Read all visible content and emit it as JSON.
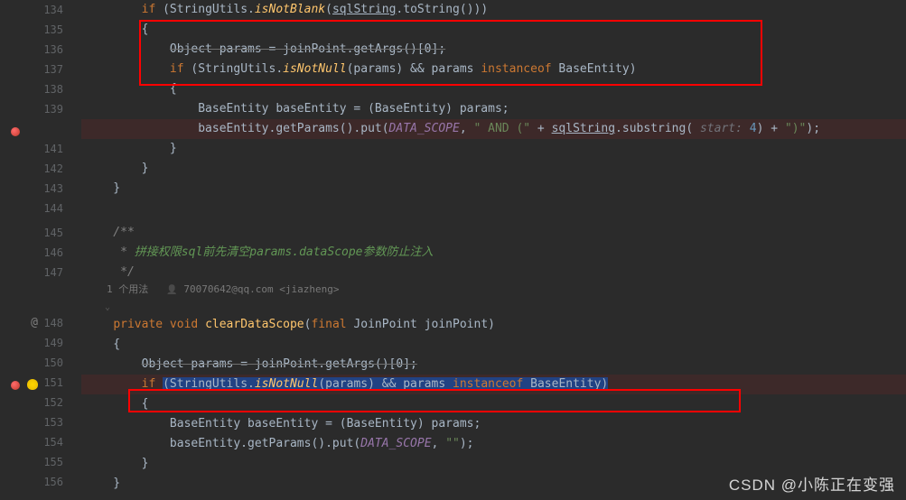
{
  "gutter": {
    "lines": [
      "134",
      "135",
      "136",
      "137",
      "138",
      "139",
      "",
      "141",
      "142",
      "143",
      "144",
      "",
      "145",
      "146",
      "147",
      "",
      "",
      "148",
      "149",
      "150",
      "151",
      "152",
      "153",
      "154",
      "155",
      "156",
      ""
    ]
  },
  "code": {
    "l134_pre": "        ",
    "l134_if": "if",
    "l134_p1": " (StringUtils.",
    "l134_m": "isNotBlank",
    "l134_p2": "(",
    "l134_u": "sqlString",
    "l134_p3": ".toString()))",
    "l135": "        {",
    "l136_pre": "            ",
    "l136_s": "Object params = joinPoint.getArgs()[0];",
    "l137_pre": "            ",
    "l137_if": "if",
    "l137_p1": " (StringUtils.",
    "l137_m": "isNotNull",
    "l137_p2": "(params) && params ",
    "l137_inst": "instanceof",
    "l137_p3": " BaseEntity)",
    "l138": "            {",
    "l139": "                BaseEntity baseEntity = (BaseEntity) params;",
    "l140_pre": "                baseEntity.getParams().put(",
    "l140_ds": "DATA_SCOPE",
    "l140_c1": ", ",
    "l140_s1": "\" AND (\"",
    "l140_c2": " + ",
    "l140_u": "sqlString",
    "l140_c3": ".substring( ",
    "l140_pn": "start:",
    "l140_n": " 4",
    "l140_c4": ") + ",
    "l140_s2": "\")\"",
    "l140_c5": ");",
    "l141": "            }",
    "l142": "        }",
    "l143": "    }",
    "l145": "    /**",
    "l146_pre": "     * ",
    "l146_t1": "拼接权限sql前先清空params.dataScope参数防止注入",
    "l147": "     */",
    "meta_usage": "1 个用法",
    "meta_author": "70070642@qq.com <jiazheng>",
    "fold": "⌄",
    "l148_pre": "    ",
    "l148_priv": "private void",
    "l148_sp": " ",
    "l148_m": "clearDataScope",
    "l148_p1": "(",
    "l148_final": "final",
    "l148_p2": " JoinPoint joinPoint)",
    "l149": "    {",
    "l150_pre": "        ",
    "l150_s": "Object params = joinPoint.getArgs()[0];",
    "l151_pre": "        ",
    "l151_if": "if",
    "l151_sp": " ",
    "l151_p1": "(StringUtils.",
    "l151_m": "isNotNull",
    "l151_p2": "(params) && params ",
    "l151_inst": "instanceof",
    "l151_p3": " BaseEntity)",
    "l152": "        {",
    "l153": "            BaseEntity baseEntity = (BaseEntity) params;",
    "l154_pre": "            baseEntity.getParams().put(",
    "l154_ds": "DATA_SCOPE",
    "l154_c1": ", ",
    "l154_s1": "\"\"",
    "l154_c2": ");",
    "l155": "        }",
    "l156": "    }"
  },
  "watermark": "CSDN @小陈正在变强"
}
